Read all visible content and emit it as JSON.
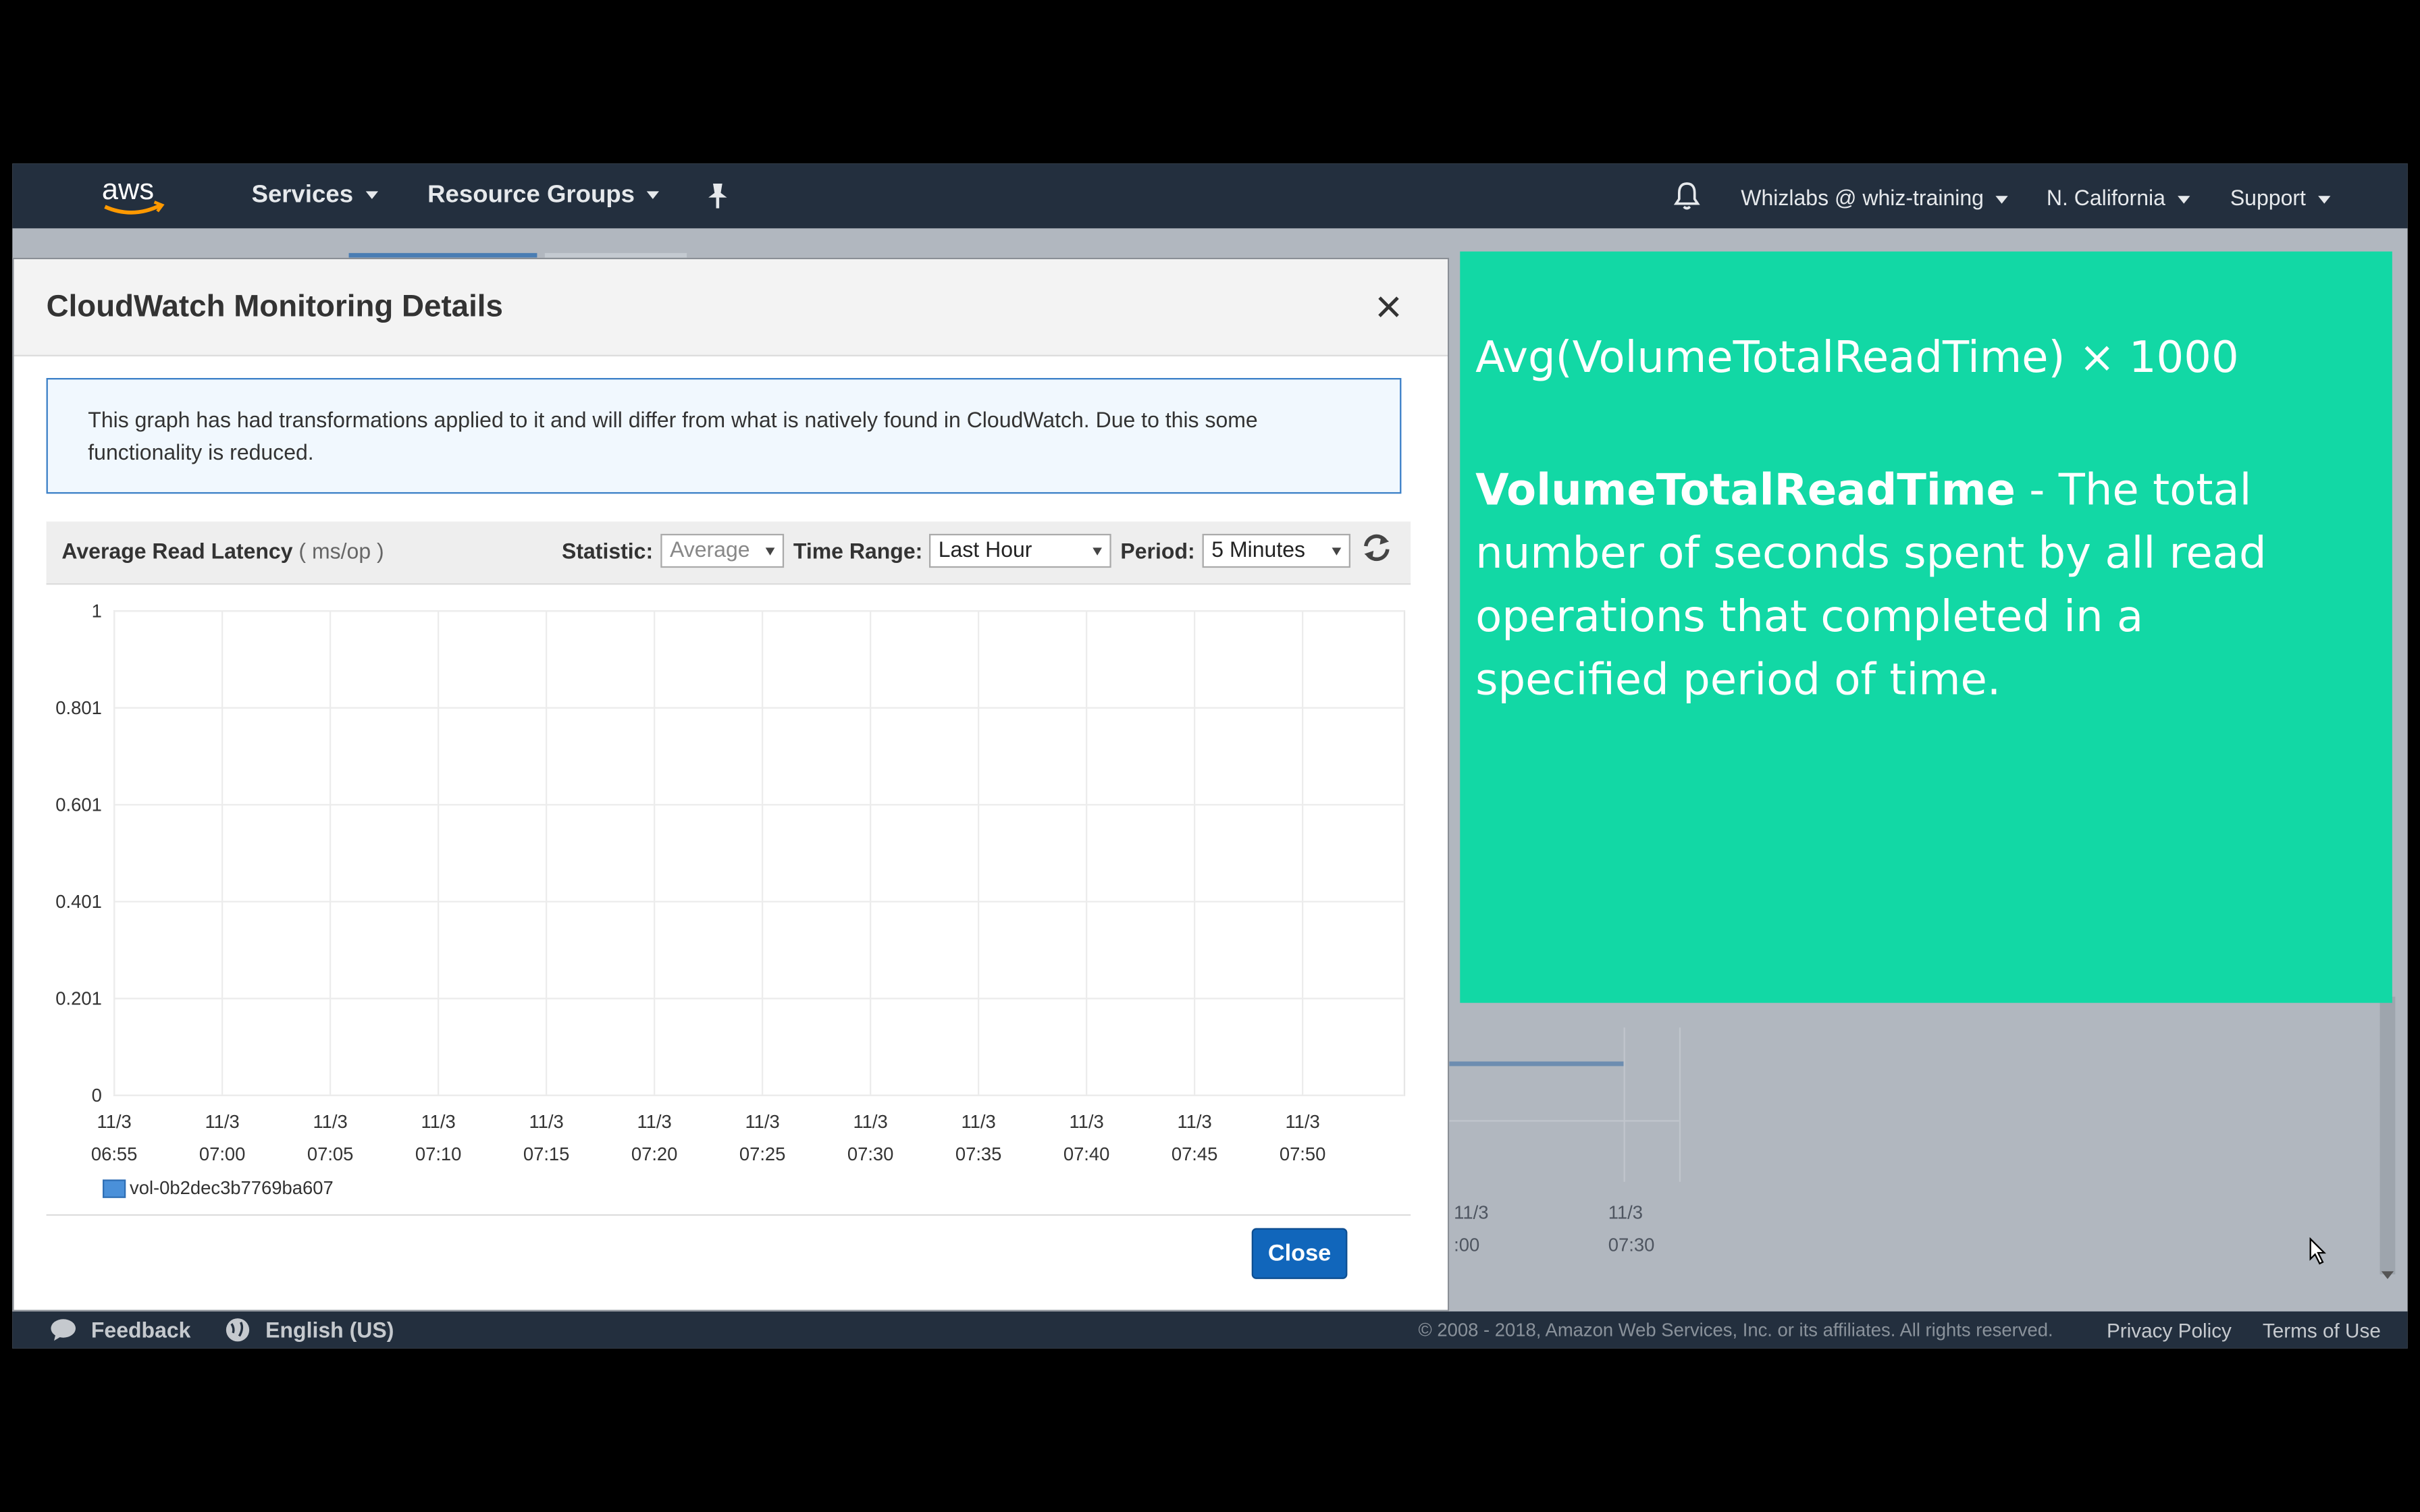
{
  "topnav": {
    "services": "Services",
    "resource_groups": "Resource Groups",
    "account": "Whizlabs @ whiz-training",
    "region": "N. California",
    "support": "Support"
  },
  "modal": {
    "title": "CloudWatch Monitoring Details",
    "close_x": "×",
    "info": "This graph has had transformations applied to it and will differ from what is natively found in CloudWatch. Due to this some functionality is reduced.",
    "close_button": "Close"
  },
  "chart_toolbar": {
    "title": "Average Read Latency",
    "unit": "( ms/op )",
    "statistic_label": "Statistic:",
    "statistic_value": "Average",
    "time_range_label": "Time Range:",
    "time_range_value": "Last Hour",
    "period_label": "Period:",
    "period_value": "5 Minutes"
  },
  "chart_data": {
    "type": "line",
    "title": "Average Read Latency",
    "ylabel": "( ms/op )",
    "y_ticks": [
      "1",
      "0.801",
      "0.601",
      "0.401",
      "0.201",
      "0"
    ],
    "ylim": [
      0,
      1
    ],
    "x_ticks": [
      [
        "11/3",
        "06:55"
      ],
      [
        "11/3",
        "07:00"
      ],
      [
        "11/3",
        "07:05"
      ],
      [
        "11/3",
        "07:10"
      ],
      [
        "11/3",
        "07:15"
      ],
      [
        "11/3",
        "07:20"
      ],
      [
        "11/3",
        "07:25"
      ],
      [
        "11/3",
        "07:30"
      ],
      [
        "11/3",
        "07:35"
      ],
      [
        "11/3",
        "07:40"
      ],
      [
        "11/3",
        "07:45"
      ],
      [
        "11/3",
        "07:50"
      ]
    ],
    "grid": true,
    "series": [
      {
        "name": "vol-0b2dec3b7769ba607",
        "color": "#4a90d9",
        "values": []
      }
    ],
    "legend": "bottom-left"
  },
  "background": {
    "x_ticks": [
      [
        "11/3",
        ":00"
      ],
      [
        "11/3",
        "07:30"
      ]
    ]
  },
  "overlay": {
    "formula": "Avg(VolumeTotalReadTime) × 1000",
    "term": "VolumeTotalReadTime",
    "definition": " - The total number of seconds spent by all read operations that completed in a specified period of time."
  },
  "footer": {
    "feedback": "Feedback",
    "language": "English (US)",
    "copyright": "© 2008 - 2018, Amazon Web Services, Inc. or its affiliates. All rights reserved.",
    "privacy": "Privacy Policy",
    "terms": "Terms of Use"
  },
  "colors": {
    "nav_bg": "#232f3e",
    "overlay_bg": "#12d8a5",
    "close_button": "#1166bb"
  }
}
